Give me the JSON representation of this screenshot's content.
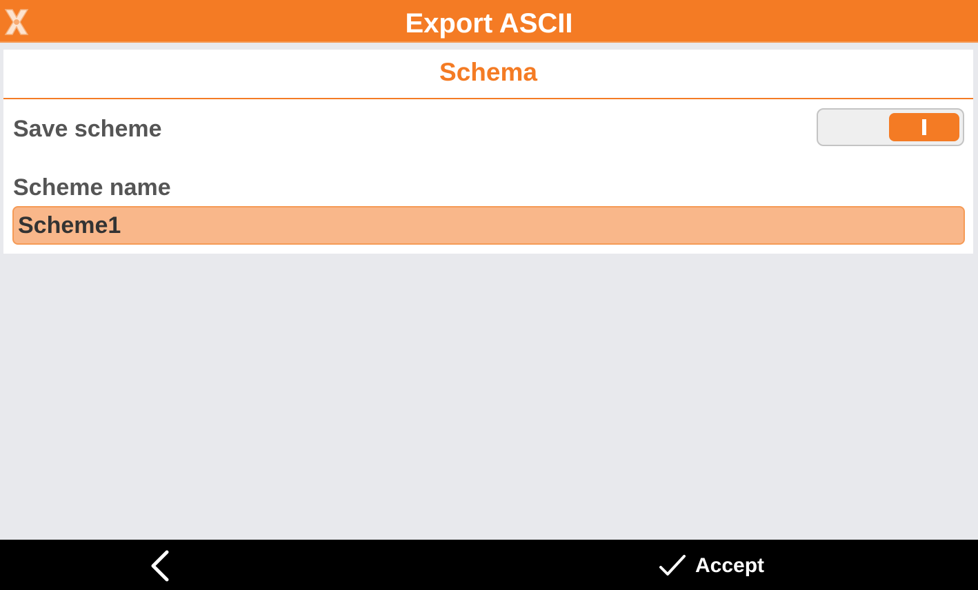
{
  "header": {
    "title": "Export ASCII",
    "logo_icon": "app-x-logo-icon",
    "accent_color": "#f47b24"
  },
  "section": {
    "title": "Schema"
  },
  "save_scheme": {
    "label": "Save scheme",
    "enabled": true
  },
  "scheme_name": {
    "label": "Scheme name",
    "value": "Scheme1"
  },
  "footer": {
    "back_icon": "chevron-left-icon",
    "accept_icon": "checkmark-icon",
    "accept_label": "Accept"
  }
}
